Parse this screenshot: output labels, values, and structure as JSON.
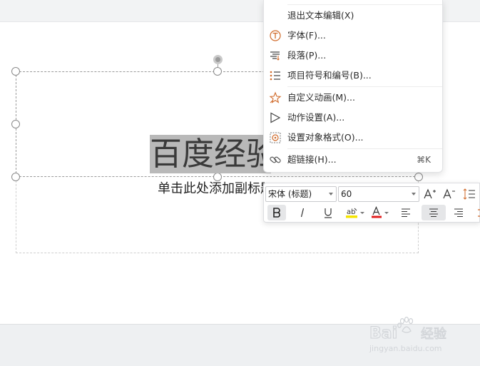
{
  "slide": {
    "title": "百度经验",
    "subtitle": "单击此处添加副标题"
  },
  "context_menu": {
    "items": [
      {
        "label": "退出文本编辑(X)",
        "icon": "none"
      },
      {
        "label": "字体(F)...",
        "icon": "font-t-circle-icon"
      },
      {
        "label": "段落(P)...",
        "icon": "paragraph-icon"
      },
      {
        "label": "项目符号和编号(B)...",
        "icon": "bullet-list-icon"
      },
      {
        "label": "自定义动画(M)...",
        "icon": "custom-animation-star-icon"
      },
      {
        "label": "动作设置(A)...",
        "icon": "action-play-icon"
      },
      {
        "label": "设置对象格式(O)...",
        "icon": "format-object-icon"
      },
      {
        "label": "超链接(H)...",
        "icon": "hyperlink-icon",
        "shortcut": "⌘K"
      }
    ]
  },
  "mini_toolbar": {
    "font_family": "宋体 (标题)",
    "font_size": "60",
    "highlight_color": "#f5e400",
    "font_color": "#e02020"
  },
  "watermark": {
    "brand": "Bai",
    "brand_suffix": "经验",
    "url": "jingyan.baidu.com"
  }
}
